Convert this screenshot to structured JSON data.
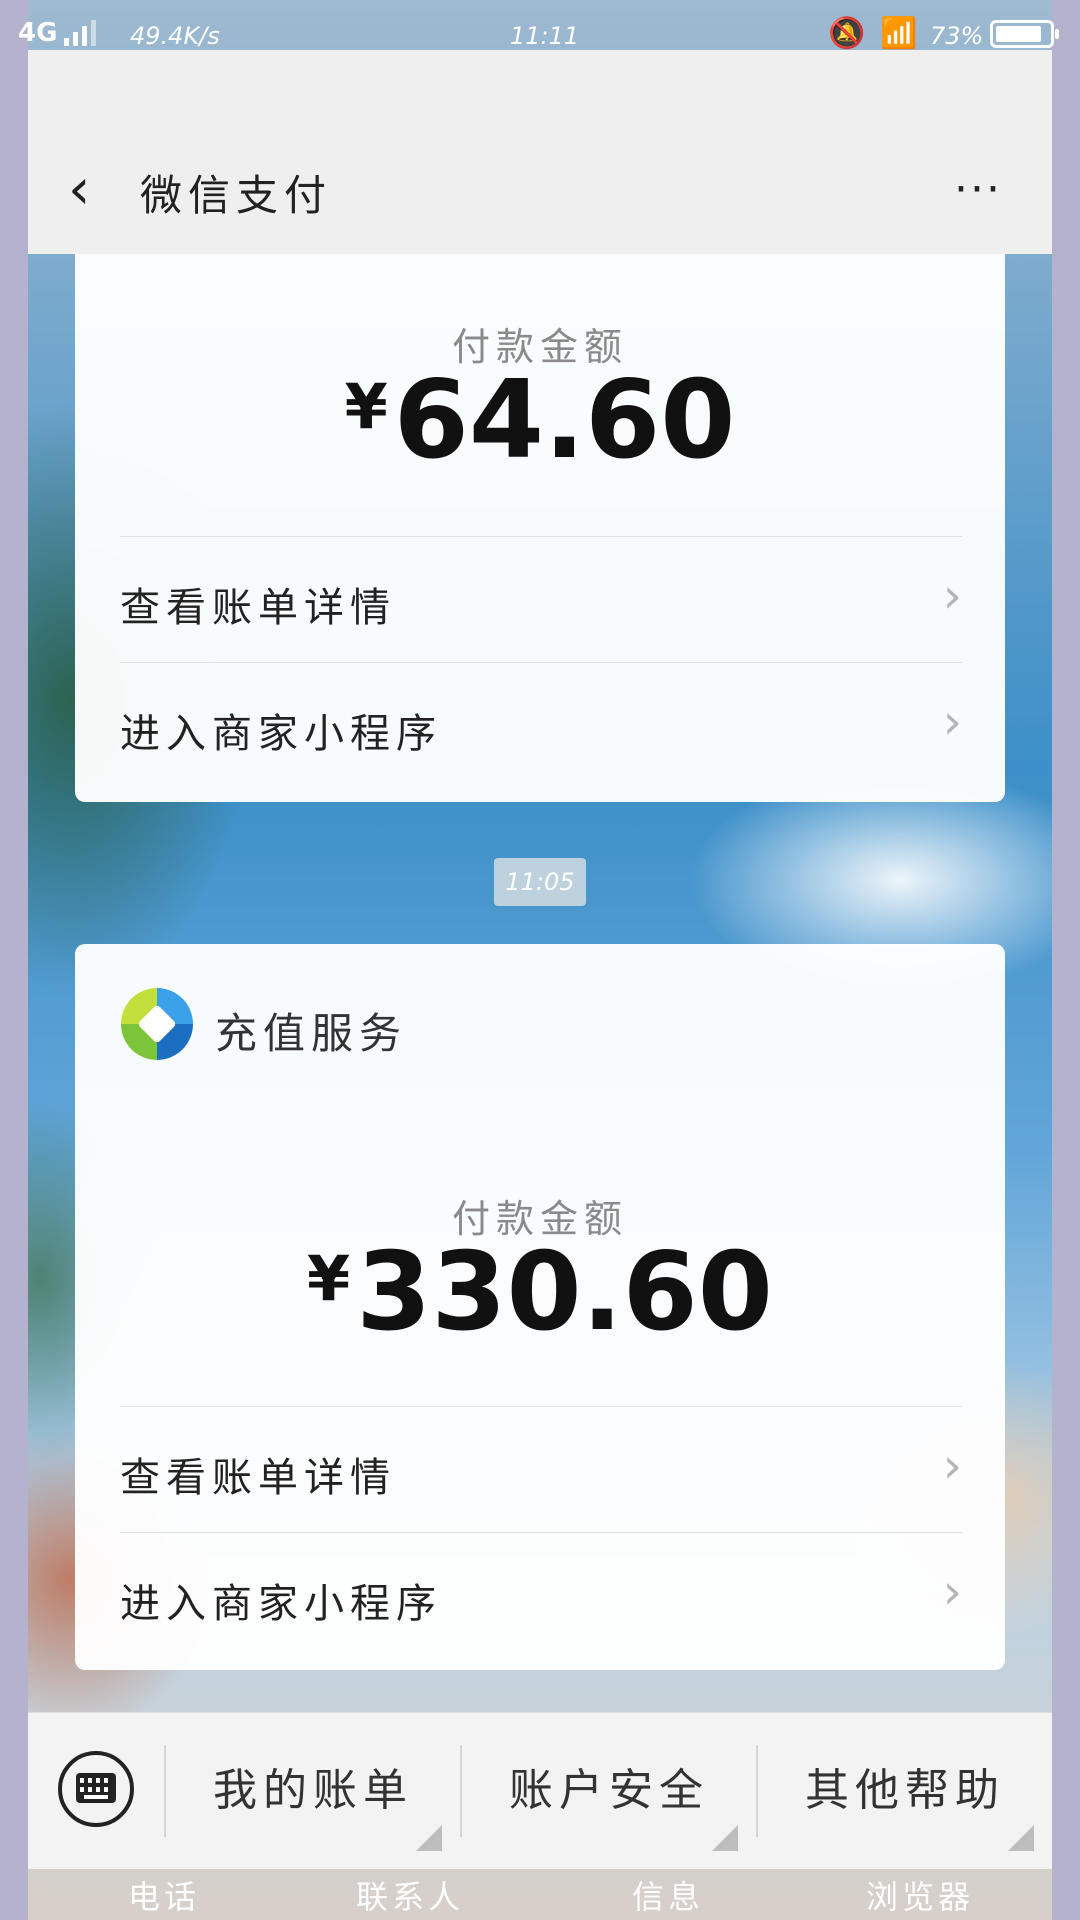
{
  "status_bar": {
    "network": "4G",
    "speed": "49.4K/s",
    "time": "11:11",
    "battery_percent": "73%",
    "battery_level": 0.73
  },
  "header": {
    "title": "微信支付"
  },
  "messages": [
    {
      "amount_label": "付款金额",
      "currency": "¥",
      "amount": "64.60",
      "actions": [
        "查看账单详情",
        "进入商家小程序"
      ]
    },
    {
      "merchant": "充值服务",
      "amount_label": "付款金额",
      "currency": "¥",
      "amount": "330.60",
      "actions": [
        "查看账单详情",
        "进入商家小程序"
      ]
    }
  ],
  "time_badge": "11:05",
  "bottom_menu": [
    "我的账单",
    "账户安全",
    "其他帮助"
  ],
  "dock": [
    "电话",
    "联系人",
    "信息",
    "浏览器"
  ],
  "icons": {
    "back": "back-arrow-icon",
    "more": "more-dots-icon",
    "keyboard": "keyboard-icon",
    "chevron": "chevron-right-icon"
  }
}
